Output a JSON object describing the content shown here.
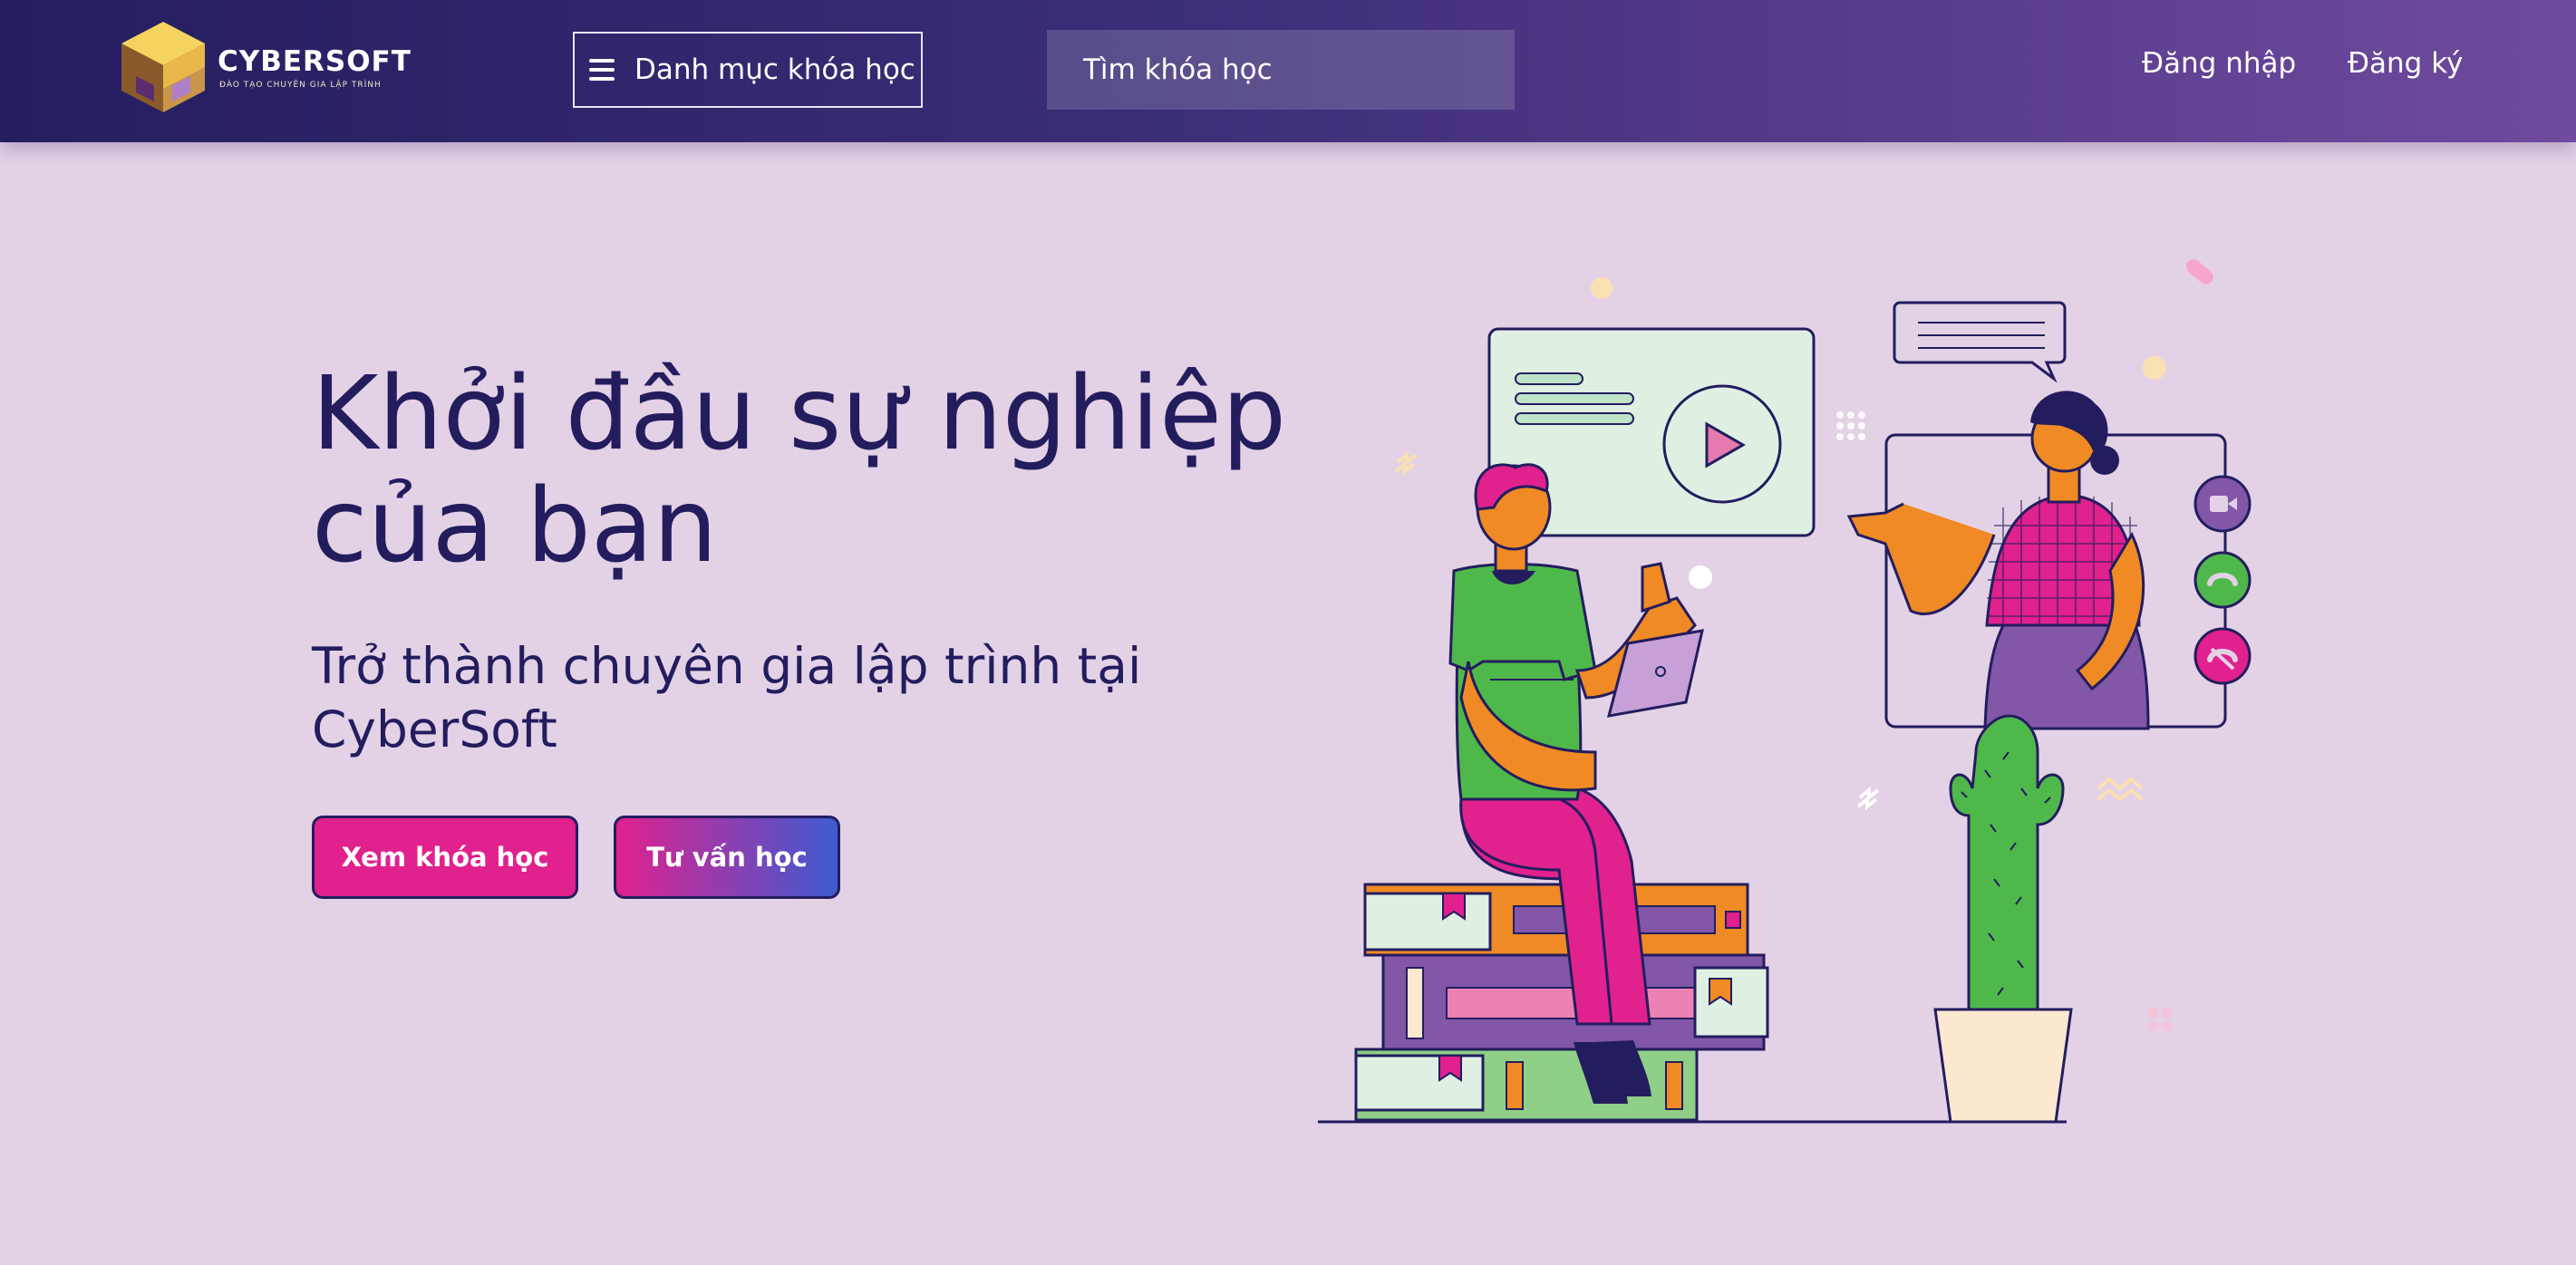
{
  "header": {
    "logo_text": "CYBERSOFT",
    "logo_tagline": "ĐÀO TẠO CHUYÊN GIA LẬP TRÌNH",
    "category_button_label": "Danh mục khóa học",
    "search_placeholder": "Tìm khóa học",
    "login_label": "Đăng nhập",
    "register_label": "Đăng ký"
  },
  "hero": {
    "title_line1": "Khởi đầu sự nghiệp",
    "title_line2": "của bạn",
    "subtitle_line1": "Trở thành chuyên gia lập trình tại",
    "subtitle_line2": "CyberSoft",
    "primary_button": "Xem khóa học",
    "secondary_button": "Tư vấn học"
  },
  "colors": {
    "page_background": "#e3d1e6",
    "header_start": "#241e5f",
    "header_end": "#6f4a9e",
    "heading_text": "#231d5e",
    "accent_pink": "#e0218e",
    "accent_blue": "#3d5bd0"
  },
  "icons": {
    "menu": "hamburger-icon",
    "logo": "cube-logo-icon",
    "video_call": "video-camera-icon",
    "accept_call": "phone-icon",
    "end_call": "phone-hangup-icon",
    "play": "play-icon"
  }
}
